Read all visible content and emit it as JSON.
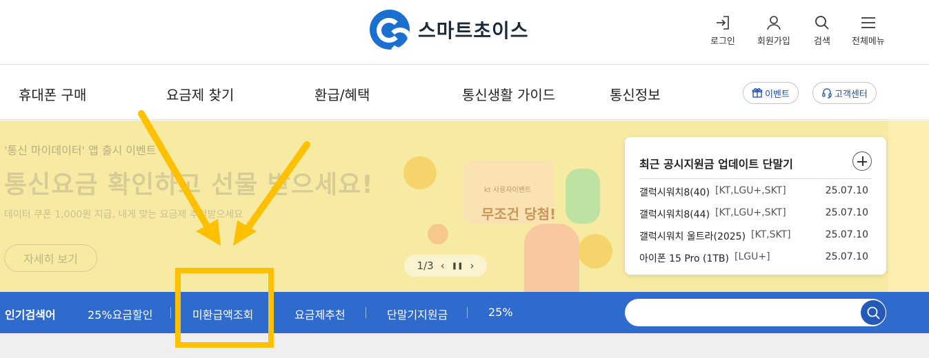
{
  "header": {
    "logo_text": "스마트초이스",
    "utils": [
      {
        "label": "로그인",
        "icon": "login-icon"
      },
      {
        "label": "회원가입",
        "icon": "user-icon"
      },
      {
        "label": "검색",
        "icon": "search-icon"
      },
      {
        "label": "전체메뉴",
        "icon": "menu-icon"
      }
    ]
  },
  "gnb": {
    "items": [
      "휴대폰 구매",
      "요금제 찾기",
      "환급/혜택",
      "통신생활 가이드",
      "통신정보"
    ],
    "event_label": "이벤트",
    "support_label": "고객센터"
  },
  "banner": {
    "subtitle": "'통신 마이데이터' 앱 출시 이벤트",
    "title": "통신요금 확인하고 선물 받으세요!",
    "desc": "데이터 쿠폰 1,000원 지급, 내게 맞는 요금제 추천받으세요",
    "button_label": "자세히 보기",
    "deco_small": "kt 사용자이벤트",
    "deco_label": "무조건 당첨!",
    "pager_text": "1/3"
  },
  "notice": {
    "title": "최근 공시지원금 업데이트 단말기",
    "rows": [
      {
        "name": "갤럭시워치8(40)",
        "carriers": "[KT,LGU+,SKT]",
        "date": "25.07.10"
      },
      {
        "name": "갤럭시워치8(44)",
        "carriers": "[KT,LGU+,SKT]",
        "date": "25.07.10"
      },
      {
        "name": "갤럭시워치 울트라(2025)",
        "carriers": "[KT,SKT]",
        "date": "25.07.10"
      },
      {
        "name": "아이폰 15 Pro (1TB)",
        "carriers": "[LGU+]",
        "date": "25.07.10"
      }
    ]
  },
  "keywords": {
    "label": "인기검색어",
    "items": [
      "25%요금할인",
      "미환급액조회",
      "요금제추천",
      "단말기지원금",
      "25%"
    ],
    "search_value": ""
  },
  "colors": {
    "brand_blue": "#2e6bcc",
    "highlight": "#ffc000",
    "banner_bg": "#f7eba4"
  }
}
